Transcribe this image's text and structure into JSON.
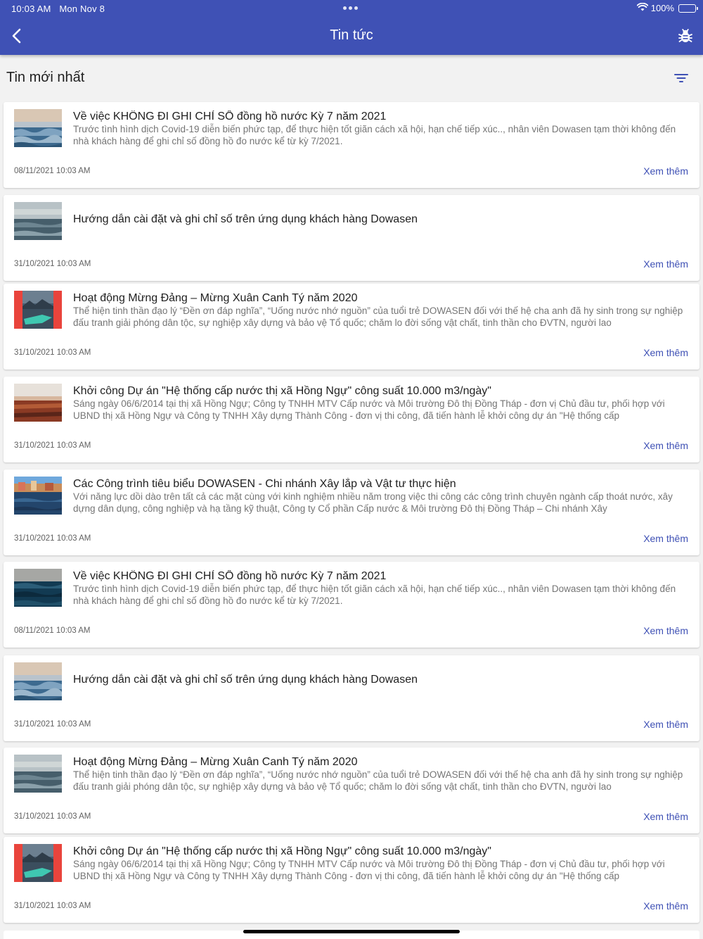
{
  "status_bar": {
    "time": "10:03 AM",
    "date": "Mon Nov 8",
    "battery": "100%"
  },
  "header": {
    "title": "Tin tức"
  },
  "section": {
    "title": "Tin mới nhất"
  },
  "icons": {
    "back": "chevron-left-icon",
    "debug": "bug-icon",
    "filter": "filter-icon",
    "wifi": "wifi-icon",
    "battery": "battery-icon"
  },
  "colors": {
    "primary": "#3f51b5",
    "background": "#f2f2f2"
  },
  "news": [
    {
      "title": "Về việc KHÔNG ĐI GHI CHỈ SỐ đồng hồ nước Kỳ 7 năm 2021",
      "desc": "Trước tình hình dịch Covid-19 diễn biến phức tạp, để thực hiện tốt giãn cách xã hội, hạn chế tiếp xúc.., nhân viên Dowasen tạm thời không đến nhà khách hàng để ghi chỉ số đồng hồ đo nước kể từ kỳ 7/2021.",
      "date": "08/11/2021 10:03 AM",
      "more": "Xem thêm",
      "thumb": "waves"
    },
    {
      "title": "Hướng dẫn cài đặt và ghi chỉ số trên ứng dụng khách hàng Dowasen",
      "desc": "",
      "date": "31/10/2021 10:03 AM",
      "more": "Xem thêm",
      "thumb": "sea"
    },
    {
      "title": "Hoạt động Mừng Đảng – Mừng Xuân Canh Tý năm 2020",
      "desc": "Thể hiện tinh thần đạo lý “Đền ơn đáp nghĩa”, “Uống nước nhớ nguồn” của tuổi trẻ DOWASEN đối với thế hệ cha anh đã hy sinh trong sự nghiệp đấu tranh giải phóng dân tộc, sự nghiệp xây dựng và bảo vệ Tổ quốc; chăm lo đời sống vật chất, tinh thần cho ĐVTN, người lao",
      "date": "31/10/2021 10:03 AM",
      "more": "Xem thêm",
      "thumb": "lake"
    },
    {
      "title": "Khởi công Dự án \"Hệ thống cấp nước thị xã Hồng Ngự\" công suất 10.000 m3/ngày\"",
      "desc": "Sáng ngày 06/6/2014 tại thị xã Hồng Ngự; Công ty TNHH MTV Cấp nước và Môi trường Đô thị Đồng Tháp - đơn vị Chủ đầu tư, phối hợp với UBND thị xã Hồng Ngự và Công ty TNHH Xây dựng Thành Công - đơn vị thi công, đã tiến hành lễ khởi công dự án \"Hệ thống cấp",
      "date": "31/10/2021 10:03 AM",
      "more": "Xem thêm",
      "thumb": "sunset"
    },
    {
      "title": "Các Công trình tiêu biểu DOWASEN - Chi nhánh Xây lắp và Vật tư thực hiện",
      "desc": "Với năng lực dồi dào trên tất cả các mặt cùng với kinh nghiệm nhiều năm trong việc thi công các công trình chuyên ngành cấp thoát nước, xây dựng dân dụng, công nghiệp và hạ tầng kỹ thuật, Công ty Cổ phần Cấp nước & Môi trường Đô thị Đồng Tháp – Chi nhánh Xây",
      "date": "31/10/2021 10:03 AM",
      "more": "Xem thêm",
      "thumb": "harbor"
    },
    {
      "title": "Về việc KHÔNG ĐI GHI CHỈ SỐ đồng hồ nước Kỳ 7 năm 2021",
      "desc": "Trước tình hình dịch Covid-19 diễn biến phức tạp, để thực hiện tốt giãn cách xã hội, hạn chế tiếp xúc.., nhân viên Dowasen tạm thời không đến nhà khách hàng để ghi chỉ số đồng hồ đo nước kể từ kỳ 7/2021.",
      "date": "08/11/2021 10:03 AM",
      "more": "Xem thêm",
      "thumb": "deep"
    },
    {
      "title": "Hướng dẫn cài đặt và ghi chỉ số trên ứng dụng khách hàng Dowasen",
      "desc": "",
      "date": "31/10/2021 10:03 AM",
      "more": "Xem thêm",
      "thumb": "waves"
    },
    {
      "title": "Hoạt động Mừng Đảng – Mừng Xuân Canh Tý năm 2020",
      "desc": "Thể hiện tinh thần đạo lý “Đền ơn đáp nghĩa”, “Uống nước nhớ nguồn” của tuổi trẻ DOWASEN đối với thế hệ cha anh đã hy sinh trong sự nghiệp đấu tranh giải phóng dân tộc, sự nghiệp xây dựng và bảo vệ Tổ quốc; chăm lo đời sống vật chất, tinh thần cho ĐVTN, người lao",
      "date": "31/10/2021 10:03 AM",
      "more": "Xem thêm",
      "thumb": "sea"
    },
    {
      "title": "Khởi công Dự án \"Hệ thống cấp nước thị xã Hồng Ngự\" công suất 10.000 m3/ngày\"",
      "desc": "Sáng ngày 06/6/2014 tại thị xã Hồng Ngự; Công ty TNHH MTV Cấp nước và Môi trường Đô thị Đồng Tháp - đơn vị Chủ đầu tư, phối hợp với UBND thị xã Hồng Ngự và Công ty TNHH Xây dựng Thành Công - đơn vị thi công, đã tiến hành lễ khởi công dự án \"Hệ thống cấp",
      "date": "31/10/2021 10:03 AM",
      "more": "Xem thêm",
      "thumb": "lake"
    }
  ]
}
